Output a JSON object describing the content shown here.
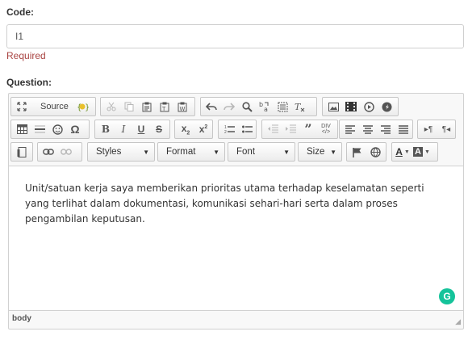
{
  "form": {
    "code_label": "Code:",
    "code_value": "I1",
    "required_text": "Required",
    "question_label": "Question:"
  },
  "editor": {
    "toolbar": {
      "source_label": "Source",
      "styles_label": "Styles",
      "format_label": "Format",
      "font_label": "Font",
      "size_label": "Size"
    },
    "content": "Unit/satuan kerja saya memberikan prioritas utama terhadap keselamatan seperti yang terlihat dalam dokumentasi, komunikasi sehari-hari serta dalam proses pengambilan keputusan.",
    "status_path": "body",
    "icons": [
      "maximize-icon",
      "source-icon",
      "spellcheck-icon",
      "cut-icon",
      "copy-icon",
      "paste-icon",
      "paste-text-icon",
      "paste-word-icon",
      "undo-icon",
      "redo-icon",
      "find-icon",
      "replace-icon",
      "select-all-icon",
      "remove-format-icon",
      "image-icon",
      "video-icon",
      "media-icon",
      "flash-icon",
      "table-icon",
      "horizontal-rule-icon",
      "smiley-icon",
      "special-char-icon",
      "bold-icon",
      "italic-icon",
      "underline-icon",
      "strike-icon",
      "subscript-icon",
      "superscript-icon",
      "numbered-list-icon",
      "bulleted-list-icon",
      "outdent-icon",
      "indent-icon",
      "blockquote-icon",
      "div-icon",
      "align-left-icon",
      "align-center-icon",
      "align-right-icon",
      "justify-icon",
      "ltr-icon",
      "rtl-icon",
      "templates-icon",
      "link-icon",
      "unlink-icon",
      "anchor-icon",
      "iframe-icon",
      "text-color-icon",
      "bg-color-icon",
      "grammarly-icon"
    ],
    "colors": {
      "grammarly": "#15c39a",
      "required": "#a94442"
    }
  }
}
